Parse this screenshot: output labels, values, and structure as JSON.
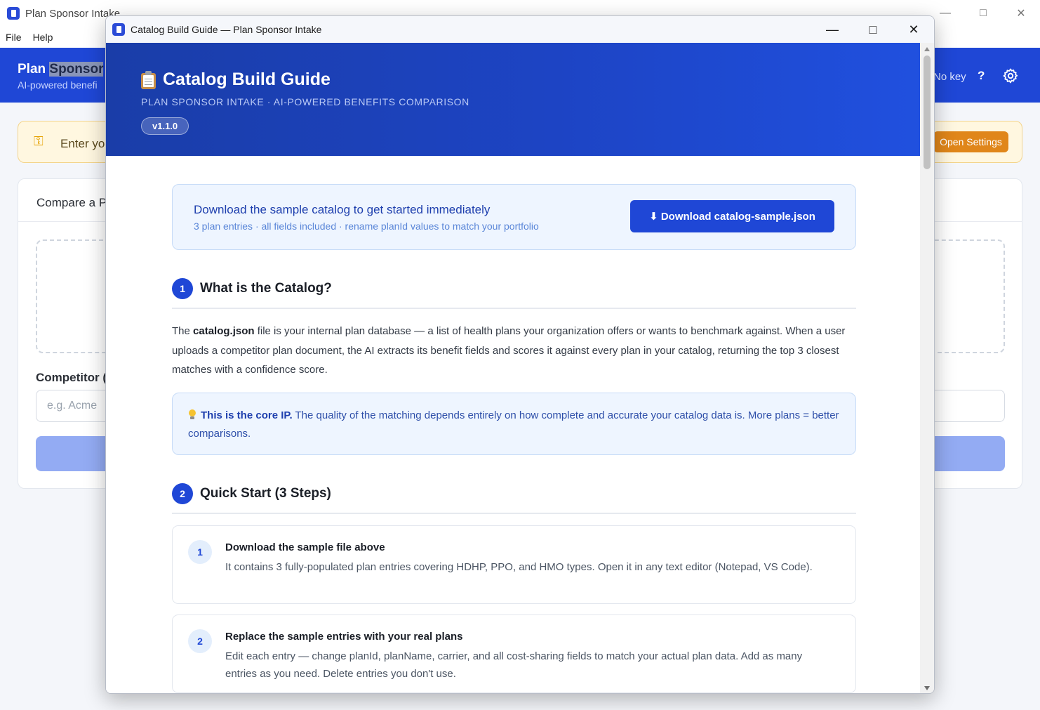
{
  "background_app": {
    "window_title": "Plan Sponsor Intake",
    "menu": [
      "File",
      "Help"
    ],
    "header_title_part1": "Plan",
    "header_title_part2": "Sponsor",
    "header_subtitle": "AI-powered benefi",
    "status_text": "No key",
    "help_label": "?",
    "key_banner_text": "Enter yo",
    "open_settings_label": "Open Settings",
    "card_title": "Compare a P",
    "competitor_label": "Competitor (",
    "competitor_placeholder": "e.g. Acme"
  },
  "dialog": {
    "window_title": "Catalog Build Guide — Plan Sponsor Intake",
    "hero": {
      "title": "Catalog Build Guide",
      "subtitle": "PLAN SPONSOR INTAKE · AI-POWERED BENEFITS COMPARISON",
      "version": "v1.1.0"
    },
    "download": {
      "title": "Download the sample catalog to get started immediately",
      "subtitle": "3 plan entries · all fields included · rename planId values to match your portfolio",
      "button_label": "⬇ Download catalog-sample.json"
    },
    "section1": {
      "number": "1",
      "title": "What is the Catalog?",
      "para_prefix": "The ",
      "para_bold": "catalog.json",
      "para_rest": " file is your internal plan database — a list of health plans your organization offers or wants to benchmark against. When a user uploads a competitor plan document, the AI extracts its benefit fields and scores it against every plan in your catalog, returning the top 3 closest matches with a confidence score.",
      "callout_bold": "This is the core IP.",
      "callout_rest": " The quality of the matching depends entirely on how complete and accurate your catalog data is. More plans = better comparisons."
    },
    "section2": {
      "number": "2",
      "title": "Quick Start (3 Steps)",
      "steps": [
        {
          "num": "1",
          "title": "Download the sample file above",
          "desc": "It contains 3 fully-populated plan entries covering HDHP, PPO, and HMO types. Open it in any text editor (Notepad, VS Code)."
        },
        {
          "num": "2",
          "title": "Replace the sample entries with your real plans",
          "desc": "Edit each entry — change planId, planName, carrier, and all cost-sharing fields to match your actual plan data. Add as many entries as you need. Delete entries you don't use."
        }
      ]
    }
  },
  "colors": {
    "primary": "#1f47d6",
    "accent_orange": "#e0861a",
    "callout_bg": "#eef5ff"
  }
}
